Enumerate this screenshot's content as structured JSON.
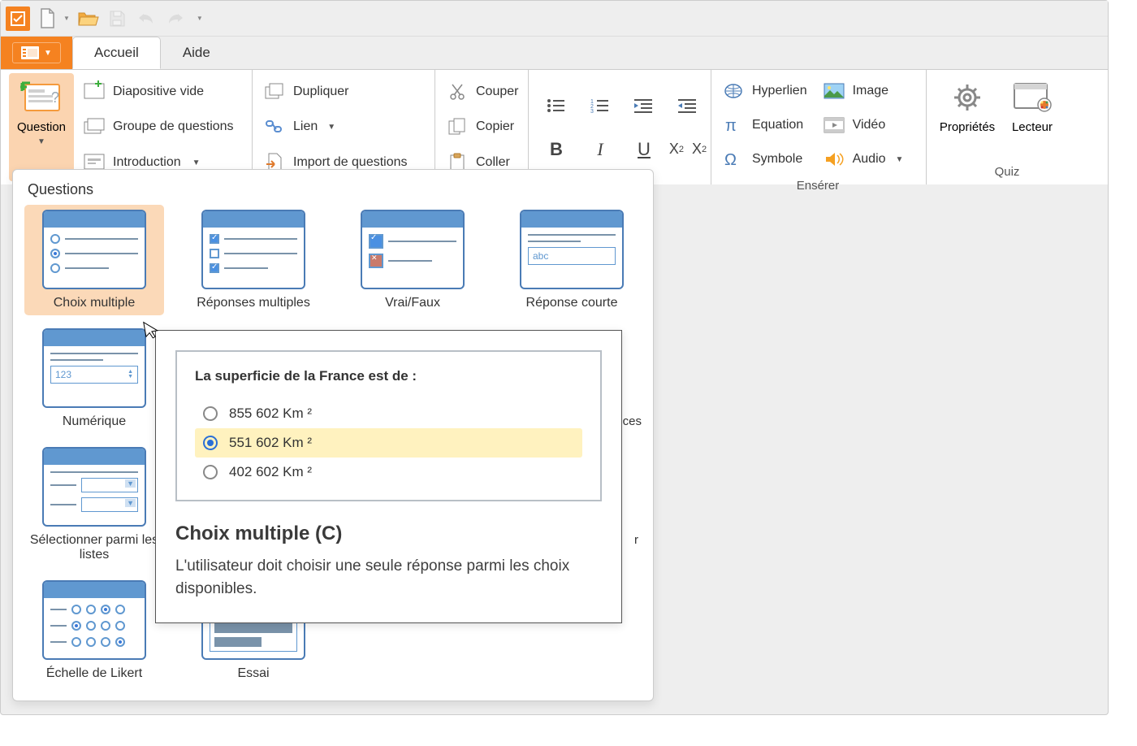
{
  "tabs": {
    "active": "Accueil",
    "other": "Aide"
  },
  "ribbon": {
    "question": "Question",
    "slides": {
      "empty": "Diapositive vide",
      "group": "Groupe de questions",
      "intro": "Introduction"
    },
    "dup": {
      "duplicate": "Dupliquer",
      "link": "Lien",
      "import": "Import de questions"
    },
    "clipboard": {
      "cut": "Couper",
      "copy": "Copier",
      "paste": "Coller"
    },
    "insert": {
      "hyperlink": "Hyperlien",
      "equation": "Equation",
      "symbol": "Symbole",
      "image": "Image",
      "video": "Vidéo",
      "audio": "Audio",
      "groupLabel": "Ensérer"
    },
    "quiz": {
      "properties": "Propriétés",
      "player": "Lecteur",
      "groupLabel": "Quiz"
    }
  },
  "panel": {
    "title": "Questions",
    "items": [
      "Choix multiple",
      "Réponses multiples",
      "Vrai/Faux",
      "Réponse courte",
      "Numérique",
      "",
      "",
      "ces",
      "Sélectionner parmi les listes",
      "",
      "",
      "r",
      "Échelle de Likert",
      "Essai"
    ]
  },
  "tooltip": {
    "cardTitle": "La superficie de la France est de :",
    "opts": [
      "855 602 Km ²",
      "551 602 Km ²",
      "402 602 Km ²"
    ],
    "heading": "Choix multiple (C)",
    "desc": "L'utilisateur doit choisir une seule réponse parmi les choix disponibles."
  },
  "thumbFieldAbc": "abc",
  "thumbField123": "123"
}
